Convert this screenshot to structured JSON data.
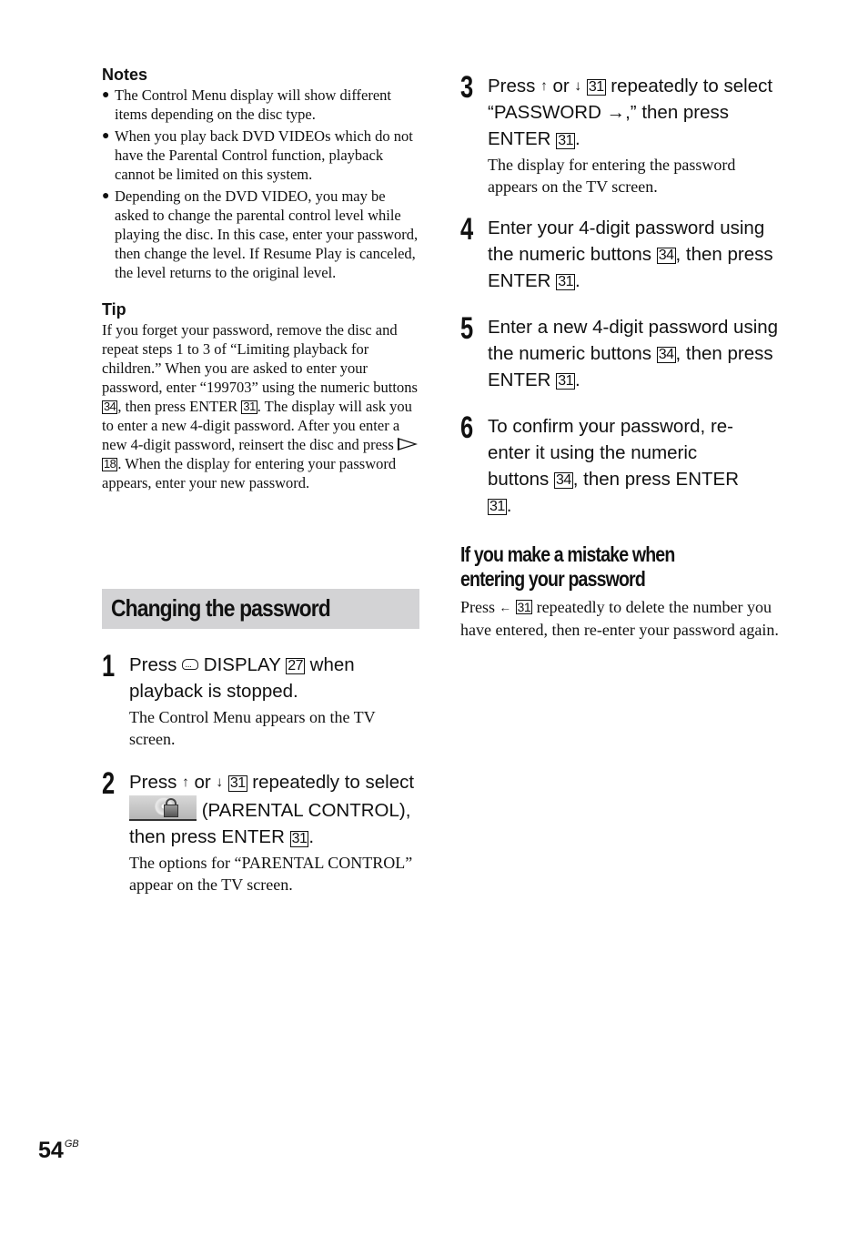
{
  "notes": {
    "heading": "Notes",
    "items": [
      "The Control Menu display will show different items depending on the disc type.",
      "When you play back DVD VIDEOs which do not have the Parental Control function, playback cannot be limited on this system.",
      "Depending on the DVD VIDEO, you may be asked to change the parental control level while playing the disc. In this case, enter your password, then change the level. If Resume Play is canceled, the level returns to the original level."
    ]
  },
  "tip": {
    "heading": "Tip",
    "part1": "If you forget your password, remove the disc and repeat steps 1 to 3 of “Limiting playback for children.” When you are asked to enter your password, enter “199703” using the numeric buttons ",
    "ref_numeric": "34",
    "part2": ", then press ENTER ",
    "ref_enter": "31",
    "part3": ". The display will ask you to enter a new 4-digit password. After you enter a new 4-digit password, reinsert the disc and press ",
    "play_icon": "play-icon",
    "ref_play": "18",
    "part4": ". When the display for entering your password appears, enter your new password."
  },
  "section": {
    "title": "Changing the password"
  },
  "steps": [
    {
      "number": "1",
      "main_a": "Press ",
      "icon": "display-icon",
      "main_b": " DISPLAY ",
      "ref": "27",
      "main_c": " when playback is stopped.",
      "sub": "The Control Menu appears on the TV screen."
    },
    {
      "number": "2",
      "main_a": "Press ",
      "up": "↑",
      "or": " or ",
      "down": "↓",
      "ref1": "31",
      "main_b": " repeatedly to select ",
      "icon": "parental-control-icon",
      "main_c": " (PARENTAL CONTROL), then press ENTER ",
      "ref2": "31",
      "main_d": ".",
      "sub": "The options for “PARENTAL CONTROL” appear on the TV screen."
    },
    {
      "number": "3",
      "main_a": "Press ",
      "up": "↑",
      "or": " or ",
      "down": "↓",
      "ref1": "31",
      "main_b": " repeatedly to select “PASSWORD →,” then press ENTER ",
      "ref2": "31",
      "main_c": ".",
      "sub": "The display for entering the password appears on the TV screen."
    },
    {
      "number": "4",
      "main_a": "Enter your 4-digit password using the numeric buttons ",
      "ref1": "34",
      "main_b": ", then press ENTER ",
      "ref2": "31",
      "main_c": "."
    },
    {
      "number": "5",
      "main_a": "Enter a new 4-digit password using the numeric buttons ",
      "ref1": "34",
      "main_b": ", then press ENTER ",
      "ref2": "31",
      "main_c": "."
    },
    {
      "number": "6",
      "main_a": "To confirm your password, re-enter it using the numeric buttons ",
      "ref1": "34",
      "main_b": ", then press ENTER ",
      "ref2": "31",
      "main_c": "."
    }
  ],
  "mistake": {
    "heading": "If you make a mistake when entering your password",
    "body_a": "Press ",
    "left_arrow": "←",
    "ref": "31",
    "body_b": " repeatedly to delete the number you have entered, then re-enter your password again."
  },
  "footer": {
    "page_number": "54",
    "region": "GB"
  }
}
